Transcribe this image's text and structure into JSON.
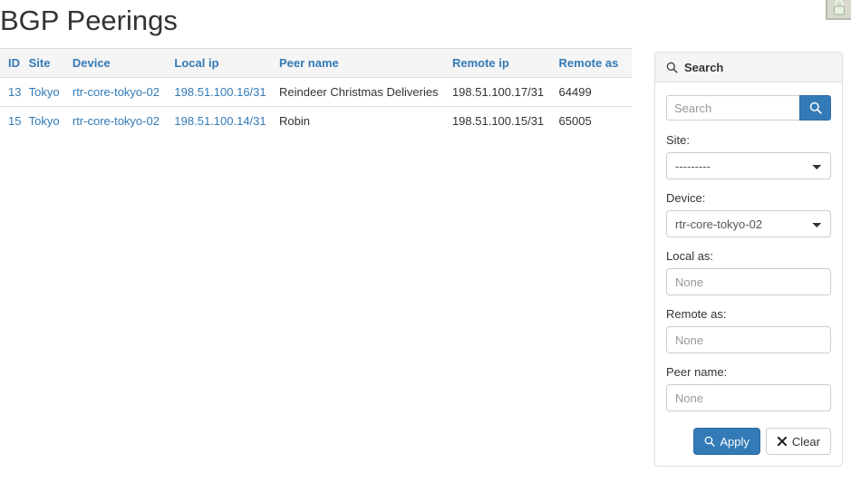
{
  "page": {
    "title": "BGP Peerings"
  },
  "corner": {
    "icon": "lock-icon"
  },
  "table": {
    "name": "bgp-peerings-table",
    "columns": [
      {
        "key": "id",
        "label": "ID"
      },
      {
        "key": "site",
        "label": "Site"
      },
      {
        "key": "device",
        "label": "Device"
      },
      {
        "key": "local_ip",
        "label": "Local ip"
      },
      {
        "key": "peer_name",
        "label": "Peer name"
      },
      {
        "key": "remote_ip",
        "label": "Remote ip"
      },
      {
        "key": "remote_as",
        "label": "Remote as"
      }
    ],
    "rows": [
      {
        "id": "13",
        "site": "Tokyo",
        "device": "rtr-core-tokyo-02",
        "local_ip": "198.51.100.16/31",
        "peer_name": "Reindeer Christmas Deliveries",
        "remote_ip": "198.51.100.17/31",
        "remote_as": "64499"
      },
      {
        "id": "15",
        "site": "Tokyo",
        "device": "rtr-core-tokyo-02",
        "local_ip": "198.51.100.14/31",
        "peer_name": "Robin",
        "remote_ip": "198.51.100.15/31",
        "remote_as": "65005"
      }
    ]
  },
  "search_panel": {
    "heading": "Search",
    "heading_icon": "search-icon",
    "search_field": {
      "value": "",
      "placeholder": "Search",
      "button_icon": "search-icon"
    },
    "fields": [
      {
        "label": "Site:",
        "name": "site",
        "type": "select",
        "value": "---------"
      },
      {
        "label": "Device:",
        "name": "device",
        "type": "select",
        "value": "rtr-core-tokyo-02"
      },
      {
        "label": "Local as:",
        "name": "local-as",
        "type": "text",
        "value": "",
        "placeholder": "None"
      },
      {
        "label": "Remote as:",
        "name": "remote-as",
        "type": "text",
        "value": "",
        "placeholder": "None"
      },
      {
        "label": "Peer name:",
        "name": "peer-name",
        "type": "text",
        "value": "",
        "placeholder": "None"
      }
    ],
    "apply_button": {
      "label": "Apply",
      "icon": "search-icon"
    },
    "clear_button": {
      "label": "Clear",
      "icon": "close-x-icon"
    }
  },
  "colors": {
    "link": "#337ab7",
    "primary": "#337ab7",
    "panel_header_bg": "#f5f5f5",
    "border": "#dddddd",
    "text": "#333333",
    "placeholder": "#999999"
  }
}
